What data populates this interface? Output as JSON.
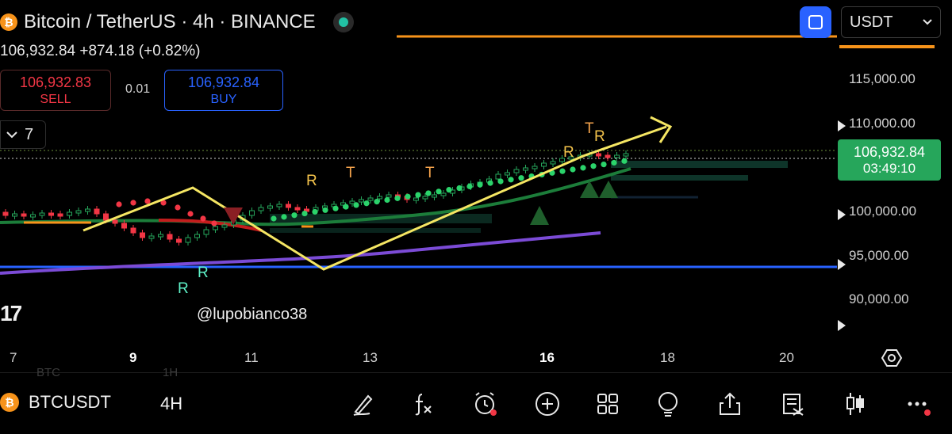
{
  "header": {
    "coin_letter": "₿",
    "title": "Bitcoin / TetherUS · 4h · BINANCE",
    "quote": "106,932.84  +874.18 (+0.82%)"
  },
  "trade": {
    "sell_price": "106,932.83",
    "sell_label": "SELL",
    "spread": "0.01",
    "buy_price": "106,932.84",
    "buy_label": "BUY"
  },
  "indicators_toggle": {
    "count": "7",
    "icon": "chevron-down-icon"
  },
  "currency": {
    "selected": "USDT"
  },
  "price_axis": {
    "labels": [
      "115,000.00",
      "110,000.00",
      "100,000.00",
      "95,000.00",
      "90,000.00"
    ],
    "current_price": "106,932.84",
    "countdown": "03:49:10"
  },
  "time_axis": {
    "labels": [
      "7",
      "9",
      "11",
      "13",
      "16",
      "18",
      "20"
    ]
  },
  "annotations": {
    "watermark": "@lupobianco38",
    "logo": "17",
    "markers": [
      "R",
      "T",
      "T",
      "R",
      "T",
      "R",
      "R",
      "R"
    ]
  },
  "bottom_bar": {
    "coin_letter": "₿",
    "symbol": "BTCUSDT",
    "interval": "4H",
    "faint_symbol": "BTC",
    "faint_interval": "1H",
    "tools": [
      "brush-icon",
      "fx-icon",
      "alarm-clock-icon",
      "plus-icon",
      "layout-grid-icon",
      "lightbulb-icon",
      "share-icon",
      "notes-icon",
      "candles-icon",
      "more-icon"
    ]
  },
  "colors": {
    "up": "#26a65b",
    "down": "#f23645",
    "accent": "#2962ff",
    "orange": "#f7931a",
    "trend_yellow": "#f5e663",
    "ma_purple": "#7b4bd6"
  }
}
